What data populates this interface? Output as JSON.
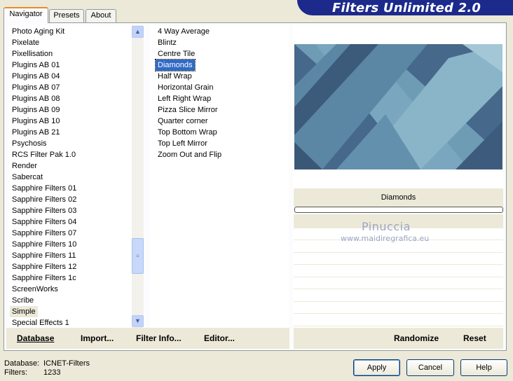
{
  "banner": {
    "title": "Filters Unlimited 2.0"
  },
  "tabs": [
    {
      "label": "Navigator",
      "active": true
    },
    {
      "label": "Presets",
      "active": false
    },
    {
      "label": "About",
      "active": false
    }
  ],
  "categories": {
    "items": [
      "Photo Aging Kit",
      "Pixelate",
      "Pixellisation",
      "Plugins AB 01",
      "Plugins AB 04",
      "Plugins AB 07",
      "Plugins AB 08",
      "Plugins AB 09",
      "Plugins AB 10",
      "Plugins AB 21",
      "Psychosis",
      "RCS Filter Pak 1.0",
      "Render",
      "Sabercat",
      "Sapphire Filters 01",
      "Sapphire Filters 02",
      "Sapphire Filters 03",
      "Sapphire Filters 04",
      "Sapphire Filters 07",
      "Sapphire Filters 10",
      "Sapphire Filters 11",
      "Sapphire Filters 12",
      "Sapphire Filters 1c",
      "ScreenWorks",
      "Scribe",
      "Simple",
      "Special Effects 1"
    ],
    "selected": "Simple"
  },
  "filters": {
    "items": [
      "4 Way Average",
      "Blintz",
      "Centre Tile",
      "Diamonds",
      "Half Wrap",
      "Horizontal Grain",
      "Left Right Wrap",
      "Pizza Slice Mirror",
      "Quarter corner",
      "Top Bottom Wrap",
      "Top Left Mirror",
      "Zoom Out and Flip"
    ],
    "selected": "Diamonds"
  },
  "toolbar": {
    "database": "Database",
    "import": "Import...",
    "filter_info": "Filter Info...",
    "editor": "Editor...",
    "randomize": "Randomize",
    "reset": "Reset"
  },
  "preview": {
    "filter_name": "Diamonds",
    "watermark_name": "Pinuccia",
    "watermark_url": "www.maidiregrafica.eu"
  },
  "footer": {
    "database_label": "Database:",
    "database_value": "ICNET-Filters",
    "filters_label": "Filters:",
    "filters_value": "1233",
    "apply": "Apply",
    "cancel": "Cancel",
    "help": "Help"
  }
}
